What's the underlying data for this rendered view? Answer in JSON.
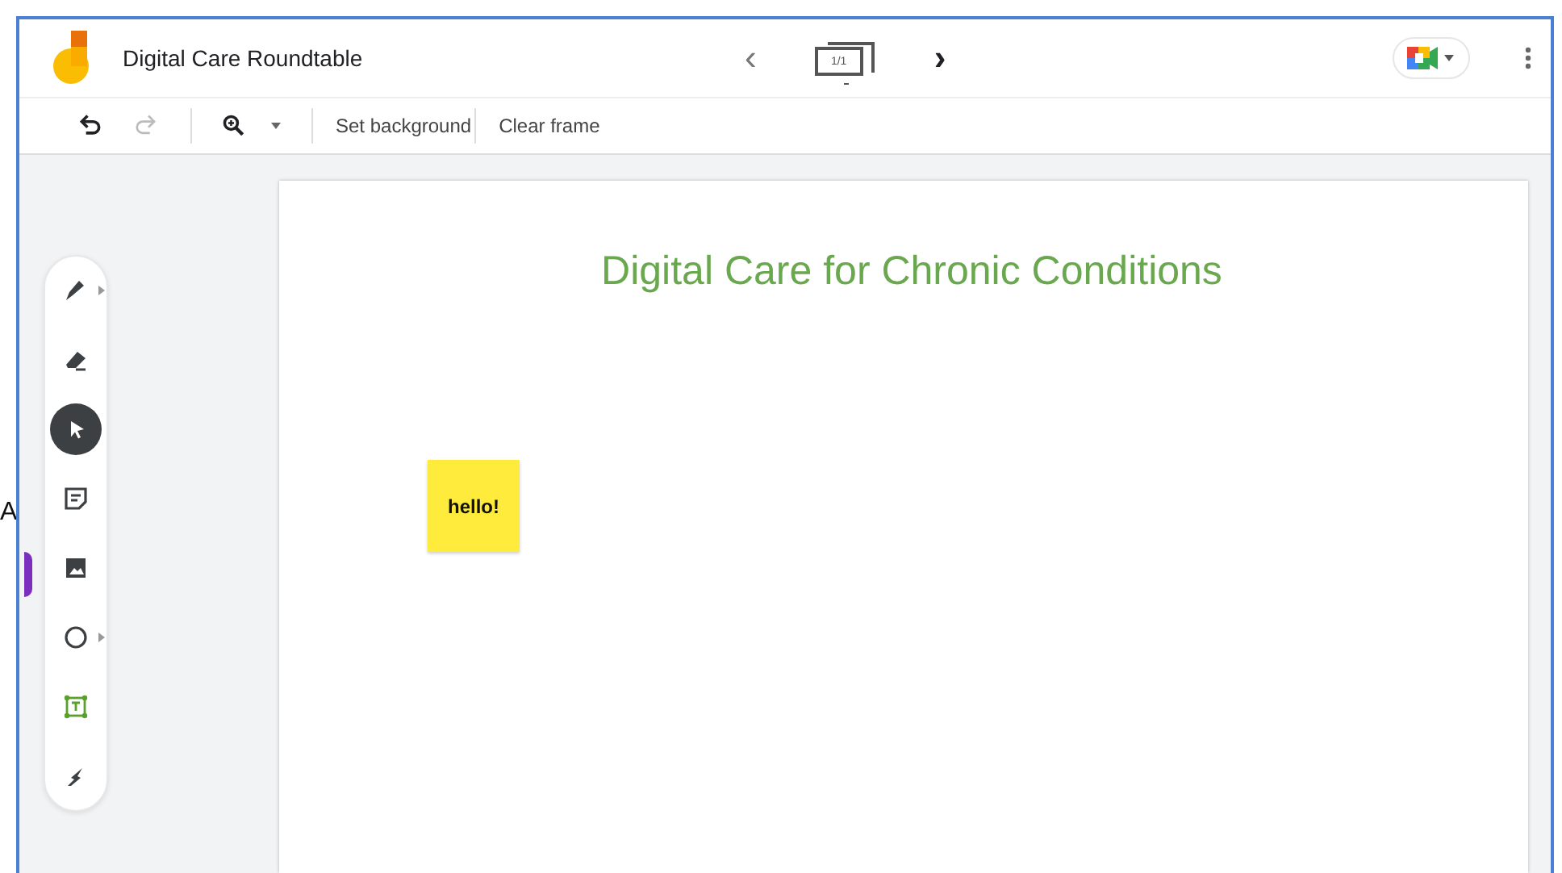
{
  "outside": {
    "letter": "A"
  },
  "header": {
    "title": "Digital Care Roundtable",
    "frame_counter": "1/1",
    "prev": "‹",
    "next": "›"
  },
  "toolbar": [
    {
      "kind": "undo",
      "disabled": false
    },
    {
      "kind": "redo",
      "disabled": true
    },
    {
      "kind": "zoom",
      "disabled": false
    },
    {
      "kind": "text",
      "label": "Set background"
    },
    {
      "kind": "text",
      "label": "Clear frame"
    }
  ],
  "tools": [
    {
      "kind": "pen",
      "selected": false,
      "submenu": true
    },
    {
      "kind": "eraser",
      "selected": false,
      "submenu": false
    },
    {
      "kind": "select",
      "selected": true,
      "submenu": false
    },
    {
      "kind": "note",
      "selected": false,
      "submenu": false
    },
    {
      "kind": "image",
      "selected": false,
      "submenu": false
    },
    {
      "kind": "shape",
      "selected": false,
      "submenu": true
    },
    {
      "kind": "textbox",
      "selected": false,
      "submenu": false
    },
    {
      "kind": "laser",
      "selected": false,
      "submenu": false
    }
  ],
  "canvas": {
    "title": "Digital Care for Chronic Conditions",
    "notes": [
      {
        "text": "hello!",
        "color": "#ffeb3b"
      }
    ]
  }
}
